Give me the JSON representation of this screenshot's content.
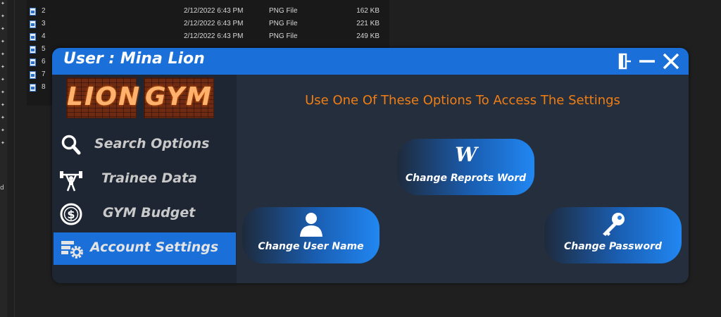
{
  "explorer": {
    "left_letter": "d",
    "rows": [
      {
        "name": "2",
        "date": "2/12/2022 6:43 PM",
        "type": "PNG File",
        "size": "162 KB"
      },
      {
        "name": "3",
        "date": "2/12/2022 6:43 PM",
        "type": "PNG File",
        "size": "221 KB"
      },
      {
        "name": "4",
        "date": "2/12/2022 6:43 PM",
        "type": "PNG File",
        "size": "249 KB"
      },
      {
        "name": "5",
        "date": "",
        "type": "",
        "size": ""
      },
      {
        "name": "6",
        "date": "",
        "type": "",
        "size": ""
      },
      {
        "name": "7",
        "date": "",
        "type": "",
        "size": ""
      },
      {
        "name": "8",
        "date": "",
        "type": "",
        "size": ""
      }
    ]
  },
  "window": {
    "title": "User : Mina Lion",
    "accent": "#1a6fd8",
    "controls": [
      "logout-icon",
      "minimize-icon",
      "close-icon"
    ]
  },
  "logo": {
    "word1": "LION",
    "word2": "GYM"
  },
  "sidebar": {
    "items": [
      {
        "label": "Search Options",
        "icon": "search-icon"
      },
      {
        "label": "Trainee Data",
        "icon": "weightlifter-icon"
      },
      {
        "label": "GYM Budget",
        "icon": "dollar-coin-icon"
      },
      {
        "label": "Account Settings",
        "icon": "account-settings-icon",
        "active": true
      }
    ]
  },
  "main": {
    "heading": "Use One Of These Options To Access The Settings",
    "heading_color": "#f07e14",
    "options": [
      {
        "label": "Change Reprots Word",
        "icon": "word-icon"
      },
      {
        "label": "Change User Name",
        "icon": "user-icon"
      },
      {
        "label": "Change Password",
        "icon": "key-icon"
      }
    ]
  }
}
